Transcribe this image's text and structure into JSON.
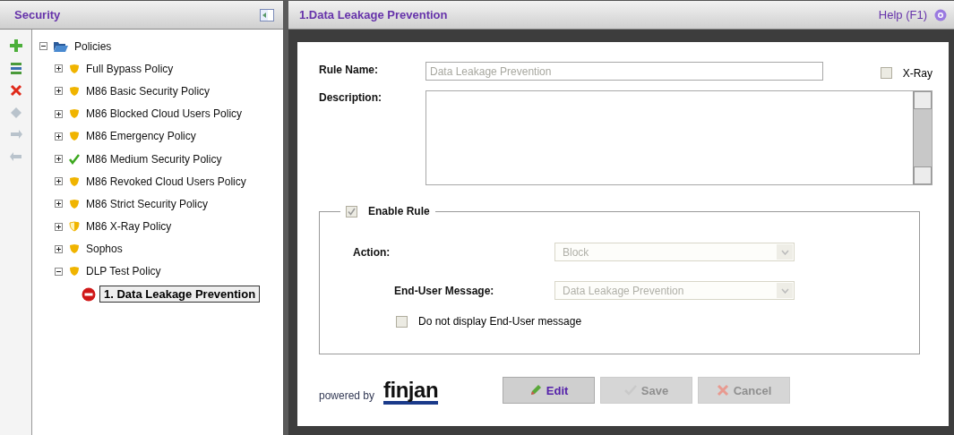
{
  "left_panel": {
    "title": "Security",
    "toolbar": [
      {
        "kind": "add",
        "disabled": false
      },
      {
        "kind": "list",
        "disabled": false
      },
      {
        "kind": "delete",
        "disabled": false
      },
      {
        "kind": "diamond",
        "disabled": true
      },
      {
        "kind": "forward",
        "disabled": true
      },
      {
        "kind": "back",
        "disabled": true
      }
    ],
    "tree": {
      "label": "Policies",
      "expanded": true,
      "children": [
        {
          "label": "Full Bypass Policy",
          "kind": "shield",
          "expanded": false,
          "selected": false
        },
        {
          "label": "M86 Basic Security Policy",
          "kind": "shield",
          "expanded": false,
          "selected": false
        },
        {
          "label": "M86 Blocked Cloud Users Policy",
          "kind": "shield",
          "expanded": false,
          "selected": false
        },
        {
          "label": "M86 Emergency Policy",
          "kind": "shield",
          "expanded": false,
          "selected": false
        },
        {
          "label": "M86 Medium Security Policy",
          "kind": "check",
          "expanded": false,
          "selected": false
        },
        {
          "label": "M86 Revoked Cloud Users Policy",
          "kind": "shield",
          "expanded": false,
          "selected": false
        },
        {
          "label": "M86 Strict Security Policy",
          "kind": "shield",
          "expanded": false,
          "selected": false
        },
        {
          "label": "M86 X-Ray Policy",
          "kind": "half-shield",
          "expanded": false,
          "selected": false
        },
        {
          "label": "Sophos",
          "kind": "shield",
          "expanded": false,
          "selected": false
        },
        {
          "label": "DLP Test Policy",
          "kind": "shield",
          "expanded": true,
          "selected": false,
          "children": [
            {
              "number": "1.",
              "label": "Data Leakage Prevention",
              "kind": "block",
              "selected": true
            }
          ]
        }
      ]
    }
  },
  "right_panel": {
    "title": "1.Data Leakage Prevention",
    "help": "Help (F1)",
    "rule_name": {
      "label": "Rule Name:",
      "value": "Data Leakage Prevention"
    },
    "xray": {
      "label": "X-Ray",
      "checked": false
    },
    "description": {
      "label": "Description:"
    },
    "enable_rule": {
      "label": "Enable Rule",
      "checked": true
    },
    "action": {
      "label": "Action:",
      "value": "Block"
    },
    "end_user_message": {
      "label": "End-User Message:",
      "value": "Data Leakage Prevention"
    },
    "do_not_display": {
      "label": "Do not display End-User message",
      "checked": false
    },
    "powered_by": "powered by",
    "logo": "finjan",
    "buttons": [
      {
        "label": "Edit",
        "kind": "edit",
        "disabled": false
      },
      {
        "label": "Save",
        "kind": "save",
        "disabled": true
      },
      {
        "label": "Cancel",
        "kind": "cancel",
        "disabled": true
      }
    ]
  }
}
